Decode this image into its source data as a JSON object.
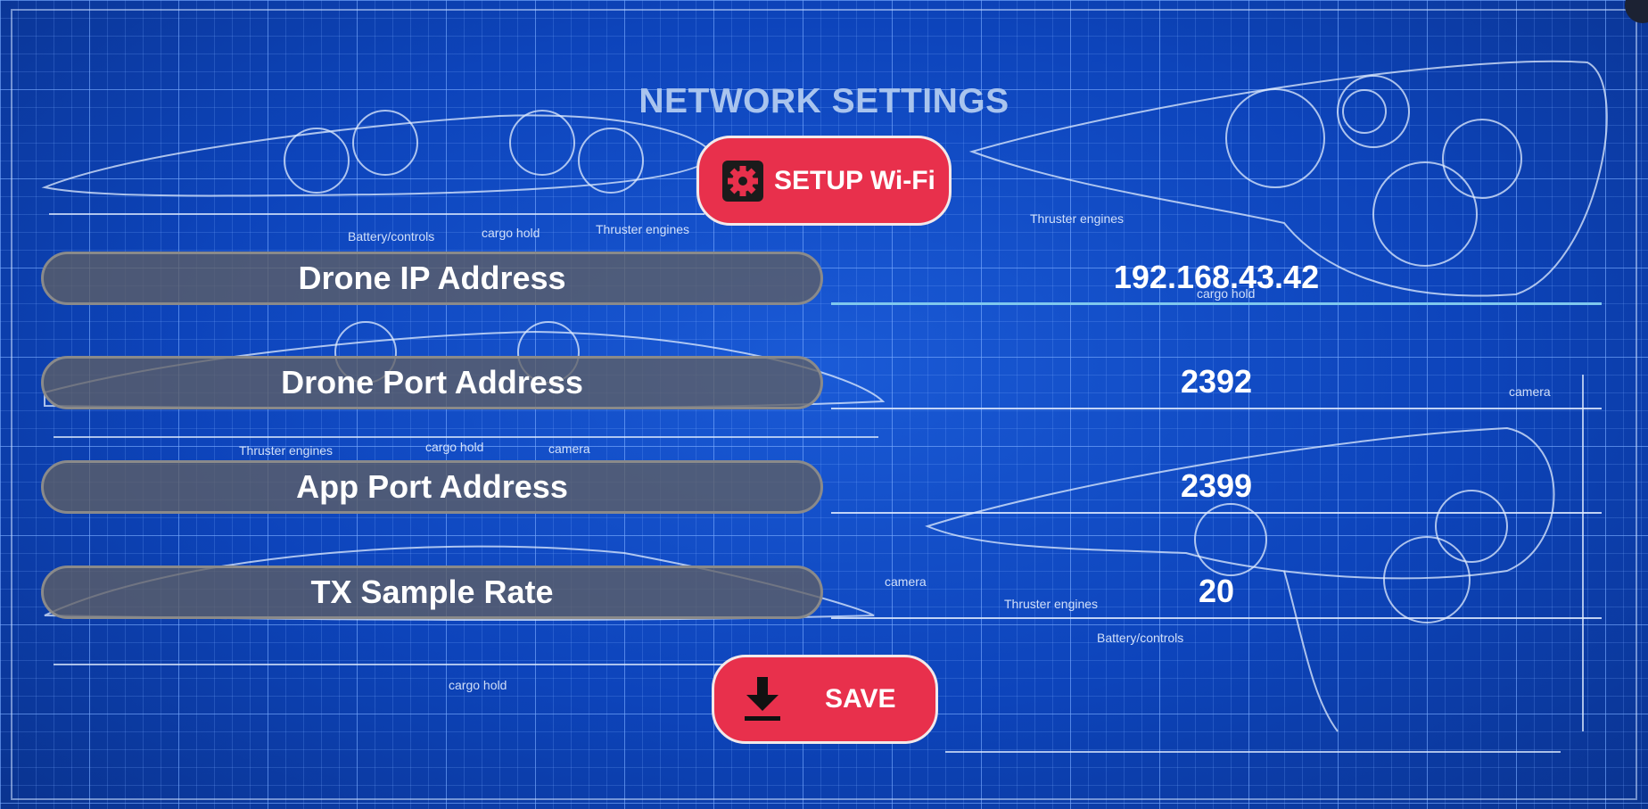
{
  "title": "NETWORK SETTINGS",
  "setup_wifi": {
    "label": "SETUP Wi-Fi",
    "icon": "gear-icon"
  },
  "fields": [
    {
      "label": "Drone IP Address",
      "value": "192.168.43.42"
    },
    {
      "label": "Drone Port Address",
      "value": "2392"
    },
    {
      "label": "App Port Address",
      "value": "2399"
    },
    {
      "label": "TX Sample Rate",
      "value": "20"
    }
  ],
  "save": {
    "label": "SAVE",
    "icon": "download-icon"
  },
  "blueprint_labels": {
    "battery_controls_1": "Battery/controls",
    "cargo_hold_1": "cargo hold",
    "thruster_engines_1": "Thruster engines",
    "thruster_engines_2": "Thruster engines",
    "cargo_hold_2": "cargo hold",
    "thruster_engines_3": "Thruster engines",
    "cargo_hold_3": "cargo hold",
    "camera_1": "camera",
    "camera_2": "camera",
    "camera_3": "camera",
    "thruster_engines_4": "Thruster engines",
    "battery_controls_2": "Battery/controls",
    "cargo_hold_4": "cargo hold"
  },
  "colors": {
    "background": "#0d44bb",
    "button": "#e8304c",
    "pill": "#5f5f64",
    "title": "#a9c4ee",
    "active_underline": "#7fc8ee"
  }
}
